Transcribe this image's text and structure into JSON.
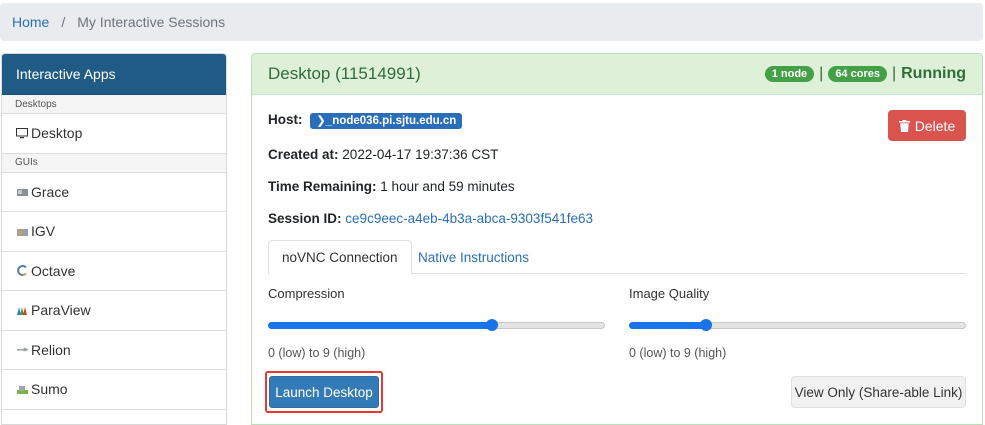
{
  "breadcrumb": {
    "home": "Home",
    "separator": "/",
    "current": "My Interactive Sessions"
  },
  "sidebar": {
    "title": "Interactive Apps",
    "groups": [
      {
        "label": "Desktops",
        "items": [
          {
            "label": "Desktop",
            "icon": "monitor-icon"
          }
        ]
      },
      {
        "label": "GUIs",
        "items": [
          {
            "label": "Grace",
            "icon": "grace-app-icon"
          },
          {
            "label": "IGV",
            "icon": "igv-app-icon"
          },
          {
            "label": "Octave",
            "icon": "octave-app-icon"
          },
          {
            "label": "ParaView",
            "icon": "paraview-app-icon"
          },
          {
            "label": "Relion",
            "icon": "relion-app-icon"
          },
          {
            "label": "Sumo",
            "icon": "sumo-app-icon"
          }
        ]
      }
    ]
  },
  "session": {
    "title": "Desktop (11514991)",
    "nodes": "1 node",
    "cores": "64 cores",
    "separator": "|",
    "status": "Running",
    "host_label": "Host:",
    "host_value": "_node036.pi.sjtu.edu.cn",
    "created_label": "Created at:",
    "created_value": "2022-04-17 19:37:36 CST",
    "time_label": "Time Remaining:",
    "time_value": "1 hour and 59 minutes",
    "session_id_label": "Session ID:",
    "session_id_value": "ce9c9eec-a4eb-4b3a-abca-9303f541fe63",
    "delete_label": "Delete"
  },
  "tabs": {
    "active": "noVNC Connection",
    "other": "Native Instructions"
  },
  "compression": {
    "label": "Compression",
    "range_text": "0 (low) to 9 (high)",
    "value": 6,
    "max": 9
  },
  "image_quality": {
    "label": "Image Quality",
    "range_text": "0 (low) to 9 (high)",
    "value": 2,
    "max": 9
  },
  "buttons": {
    "launch": "Launch Desktop",
    "view_only": "View Only (Share-able Link)"
  },
  "colors": {
    "sidebar_header": "#1f5b85",
    "badge_green": "#43a047",
    "link": "#2a6ebb",
    "delete": "#d9534f",
    "launch": "#337ab7",
    "highlight": "#e53935"
  }
}
